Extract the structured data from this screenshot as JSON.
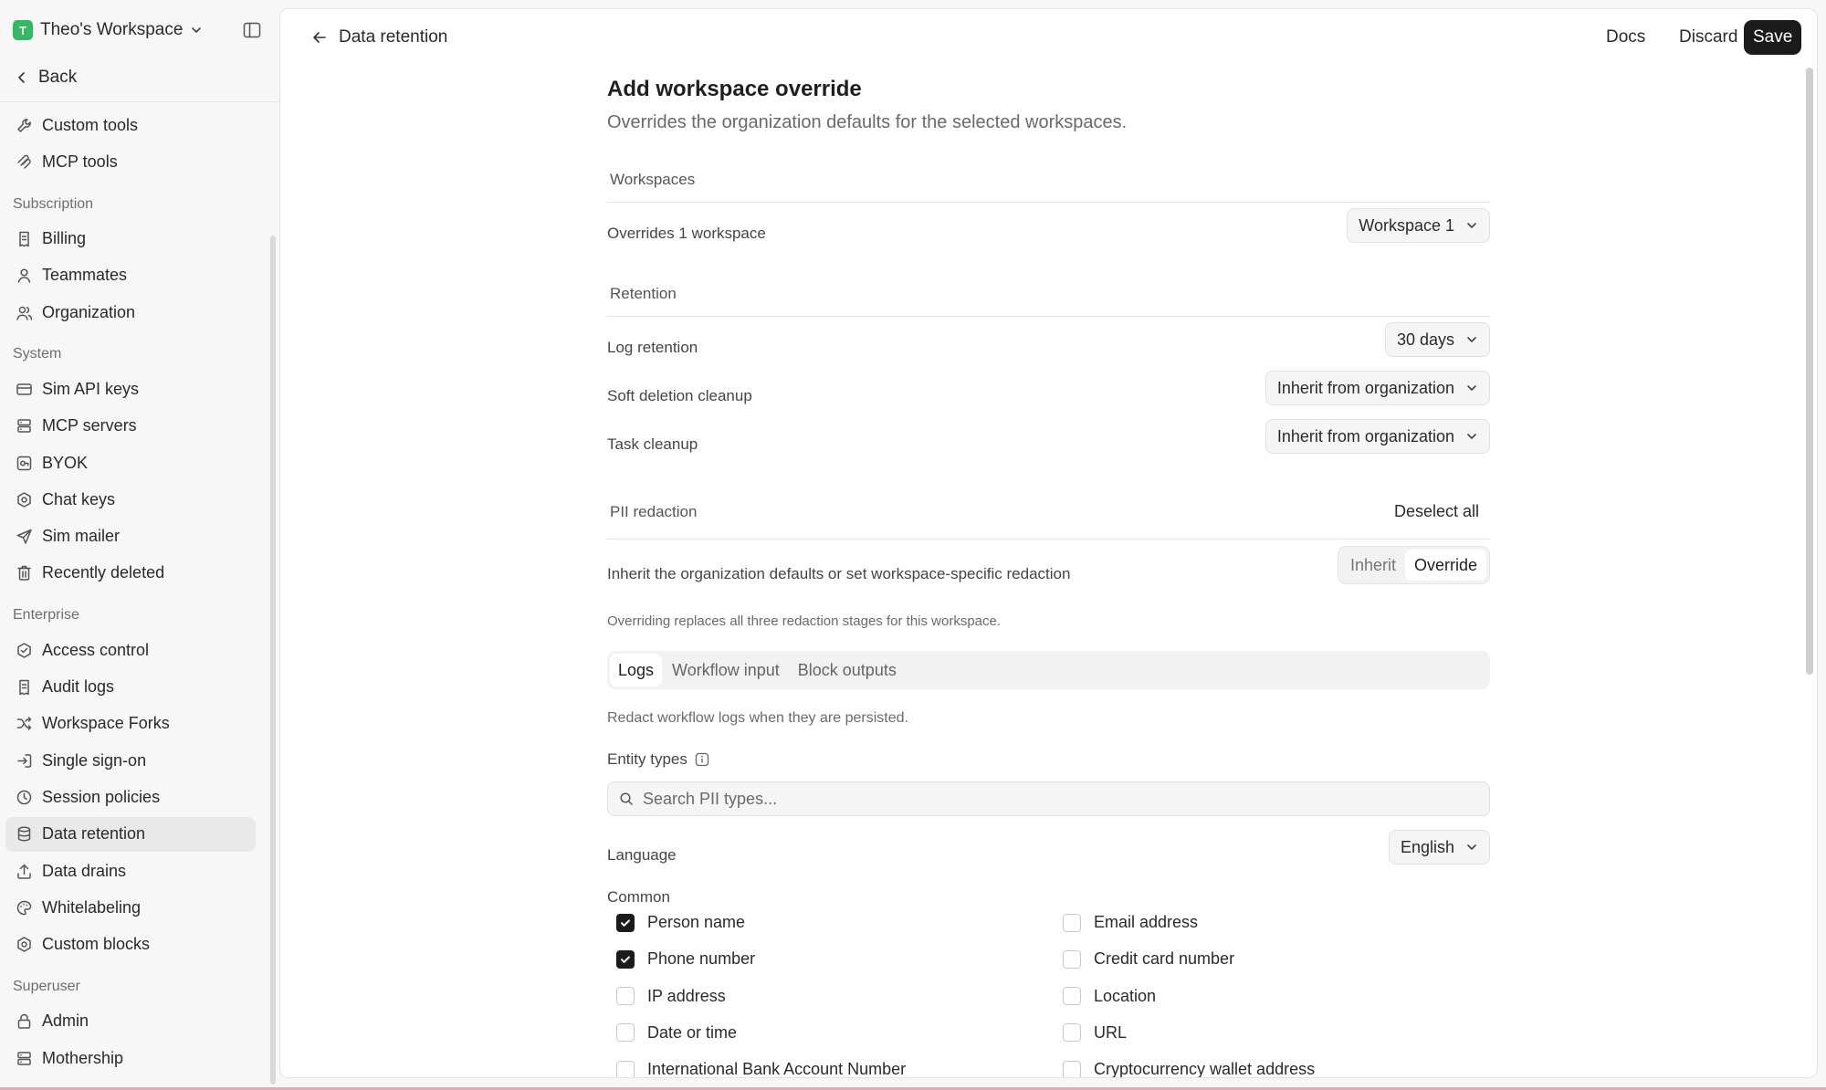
{
  "workspace": {
    "badge": "T",
    "name": "Theo's Workspace"
  },
  "sidebar": {
    "back_label": "Back",
    "sections": [
      {
        "title": "",
        "items": [
          {
            "label": "Custom tools",
            "icon": "wrench-icon"
          },
          {
            "label": "MCP tools",
            "icon": "mcp-icon"
          }
        ]
      },
      {
        "title": "Subscription",
        "items": [
          {
            "label": "Billing",
            "icon": "receipt-icon"
          },
          {
            "label": "Teammates",
            "icon": "user-icon"
          },
          {
            "label": "Organization",
            "icon": "users-icon"
          }
        ]
      },
      {
        "title": "System",
        "items": [
          {
            "label": "Sim API keys",
            "icon": "card-icon"
          },
          {
            "label": "MCP servers",
            "icon": "server-icon"
          },
          {
            "label": "BYOK",
            "icon": "key-box-icon"
          },
          {
            "label": "Chat keys",
            "icon": "hexagon-icon"
          },
          {
            "label": "Sim mailer",
            "icon": "send-icon"
          },
          {
            "label": "Recently deleted",
            "icon": "trash-icon"
          }
        ]
      },
      {
        "title": "Enterprise",
        "items": [
          {
            "label": "Access control",
            "icon": "shield-check-icon"
          },
          {
            "label": "Audit logs",
            "icon": "receipt-icon"
          },
          {
            "label": "Workspace Forks",
            "icon": "shuffle-icon"
          },
          {
            "label": "Single sign-on",
            "icon": "login-icon"
          },
          {
            "label": "Session policies",
            "icon": "clock-icon"
          },
          {
            "label": "Data retention",
            "icon": "database-icon",
            "active": true
          },
          {
            "label": "Data drains",
            "icon": "upload-icon"
          },
          {
            "label": "Whitelabeling",
            "icon": "palette-icon"
          },
          {
            "label": "Custom blocks",
            "icon": "hexagon-icon"
          }
        ]
      },
      {
        "title": "Superuser",
        "items": [
          {
            "label": "Admin",
            "icon": "lock-icon"
          },
          {
            "label": "Mothership",
            "icon": "server-icon"
          }
        ]
      }
    ]
  },
  "topbar": {
    "breadcrumb": "Data retention",
    "docs_label": "Docs",
    "discard_label": "Discard",
    "save_label": "Save"
  },
  "form": {
    "title": "Add workspace override",
    "subtitle": "Overrides the organization defaults for the selected workspaces.",
    "workspaces": {
      "heading": "Workspaces",
      "label": "Overrides 1 workspace",
      "value": "Workspace 1"
    },
    "retention": {
      "heading": "Retention",
      "log_label": "Log retention",
      "log_value": "30 days",
      "soft_label": "Soft deletion cleanup",
      "soft_value": "Inherit from organization",
      "task_label": "Task cleanup",
      "task_value": "Inherit from organization"
    },
    "pii": {
      "heading": "PII redaction",
      "deselect_label": "Deselect all",
      "mode_label": "Inherit the organization defaults or set workspace-specific redaction",
      "mode_inherit": "Inherit",
      "mode_override": "Override",
      "note": "Overriding replaces all three redaction stages for this workspace.",
      "tabs": [
        "Logs",
        "Workflow input",
        "Block outputs"
      ],
      "tab_desc": "Redact workflow logs when they are persisted.",
      "entity_label": "Entity types",
      "search_placeholder": "Search PII types...",
      "language_label": "Language",
      "language_value": "English",
      "common_label": "Common",
      "left_items": [
        {
          "label": "Person name",
          "checked": true
        },
        {
          "label": "Phone number",
          "checked": true
        },
        {
          "label": "IP address",
          "checked": false
        },
        {
          "label": "Date or time",
          "checked": false
        },
        {
          "label": "International Bank Account Number",
          "checked": false
        }
      ],
      "right_items": [
        {
          "label": "Email address",
          "checked": false
        },
        {
          "label": "Credit card number",
          "checked": false
        },
        {
          "label": "Location",
          "checked": false
        },
        {
          "label": "URL",
          "checked": false
        },
        {
          "label": "Cryptocurrency wallet address",
          "checked": false
        }
      ]
    }
  },
  "colors": {
    "accent": "#1b1b1b",
    "workspace_badge": "#33b864",
    "active_nav": "#e9e9e9"
  }
}
